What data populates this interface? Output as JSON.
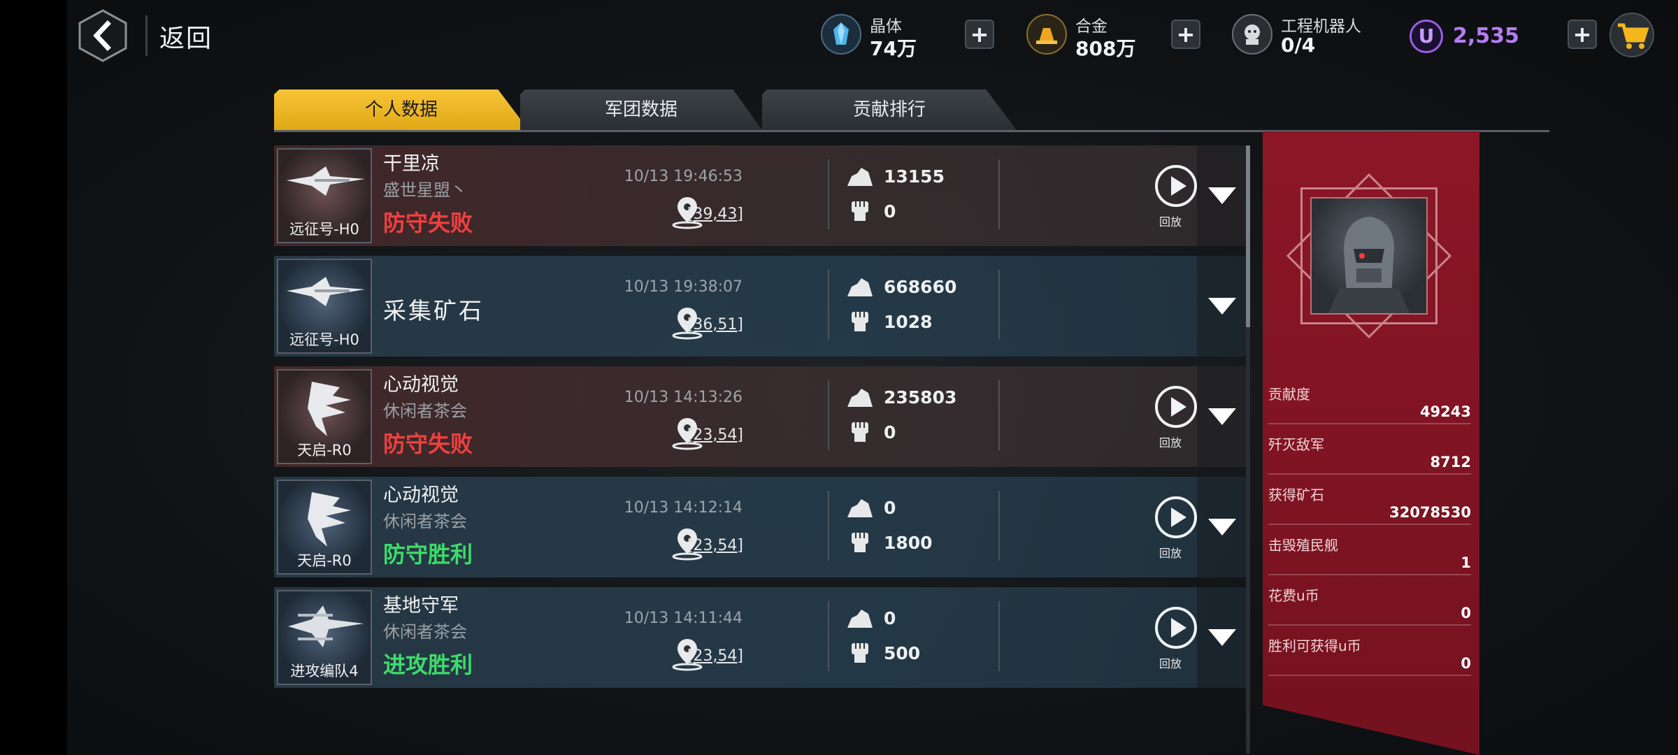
{
  "header": {
    "back_label": "返回",
    "crystal": {
      "name": "晶体",
      "value": "74万"
    },
    "alloy": {
      "name": "合金",
      "value": "808万"
    },
    "robot": {
      "name": "工程机器人",
      "value": "0/4"
    },
    "ucoin": {
      "symbol": "U",
      "value": "2,535"
    }
  },
  "tabs": [
    {
      "label": "个人数据",
      "active": true
    },
    {
      "label": "军团数据",
      "active": false
    },
    {
      "label": "贡献排行",
      "active": false
    }
  ],
  "records": [
    {
      "ship": "远征号-H0",
      "name": "干里凉",
      "guild": "盛世星盟丶",
      "title_only": false,
      "result": "防守失败",
      "result_type": "fail",
      "time": "10/13 19:46:53",
      "coord": "[39,43]",
      "ore": "13155",
      "kills": "0",
      "replay_label": "回放",
      "has_replay": true,
      "theme": "red"
    },
    {
      "ship": "远征号-H0",
      "name": "采集矿石",
      "guild": "",
      "title_only": true,
      "result": "",
      "result_type": "",
      "time": "10/13 19:38:07",
      "coord": "[36,51]",
      "ore": "668660",
      "kills": "1028",
      "replay_label": "",
      "has_replay": false,
      "theme": "blue"
    },
    {
      "ship": "天启-R0",
      "name": "心动视觉",
      "guild": "休闲者茶会",
      "title_only": false,
      "result": "防守失败",
      "result_type": "fail",
      "time": "10/13 14:13:26",
      "coord": "[23,54]",
      "ore": "235803",
      "kills": "0",
      "replay_label": "回放",
      "has_replay": true,
      "theme": "red"
    },
    {
      "ship": "天启-R0",
      "name": "心动视觉",
      "guild": "休闲者茶会",
      "title_only": false,
      "result": "防守胜利",
      "result_type": "win",
      "time": "10/13 14:12:14",
      "coord": "[23,54]",
      "ore": "0",
      "kills": "1800",
      "replay_label": "回放",
      "has_replay": true,
      "theme": "blue"
    },
    {
      "ship": "进攻编队4",
      "name": "基地守军",
      "guild": "休闲者茶会",
      "title_only": false,
      "result": "进攻胜利",
      "result_type": "win",
      "time": "10/13 14:11:44",
      "coord": "[23,54]",
      "ore": "0",
      "kills": "500",
      "replay_label": "回放",
      "has_replay": true,
      "theme": "blue"
    }
  ],
  "summary": [
    {
      "label": "贡献度",
      "value": "49243"
    },
    {
      "label": "歼灭敌军",
      "value": "8712"
    },
    {
      "label": "获得矿石",
      "value": "32078530"
    },
    {
      "label": "击毁殖民舰",
      "value": "1"
    },
    {
      "label": "花费u币",
      "value": "0"
    },
    {
      "label": "胜利可获得u币",
      "value": "0"
    }
  ],
  "colors": {
    "fail": "#f0403f",
    "win": "#3ddc6a",
    "accent": "#f2bb2b",
    "panel": "#8c1626",
    "ucoin": "#b57cf2"
  }
}
